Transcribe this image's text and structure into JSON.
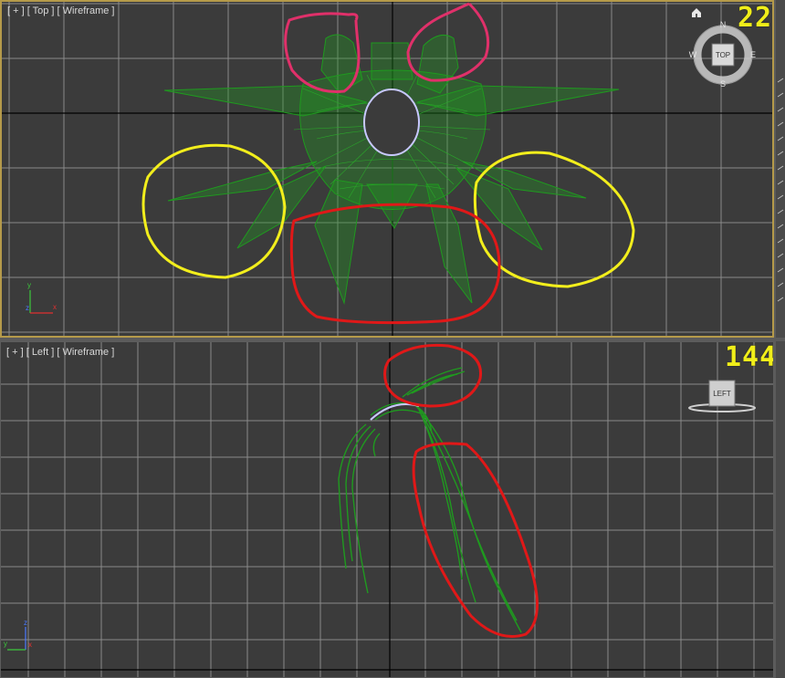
{
  "viewports": {
    "top": {
      "label": "[ + ] [ Top ] [ Wireframe ]",
      "frame": "22",
      "cube_label": "TOP",
      "compass": {
        "n": "N",
        "s": "S",
        "e": "E",
        "w": "W"
      },
      "gizmo": {
        "x": "x",
        "y": "y",
        "z": "z"
      }
    },
    "left": {
      "label": "[ + ] [ Left ] [ Wireframe ]",
      "frame": "144",
      "cube_label": "LEFT",
      "gizmo": {
        "x": "x",
        "y": "y",
        "z": "z"
      }
    }
  },
  "colors": {
    "viewport_bg": "#3b3b3b",
    "grid": "#8a8a8a",
    "axis": "#000000",
    "mesh": "#1f9a1f",
    "mesh_selected": "#c8c8ff",
    "active_border": "#b59a4a",
    "frame_counter": "#f0ee1a",
    "annot_pink": "#e0306a",
    "annot_yellow": "#f2ee1c",
    "annot_red": "#e01818"
  },
  "icons": [
    "home-icon",
    "viewcube-top-icon",
    "viewcube-left-icon",
    "axis-gizmo-icon"
  ]
}
